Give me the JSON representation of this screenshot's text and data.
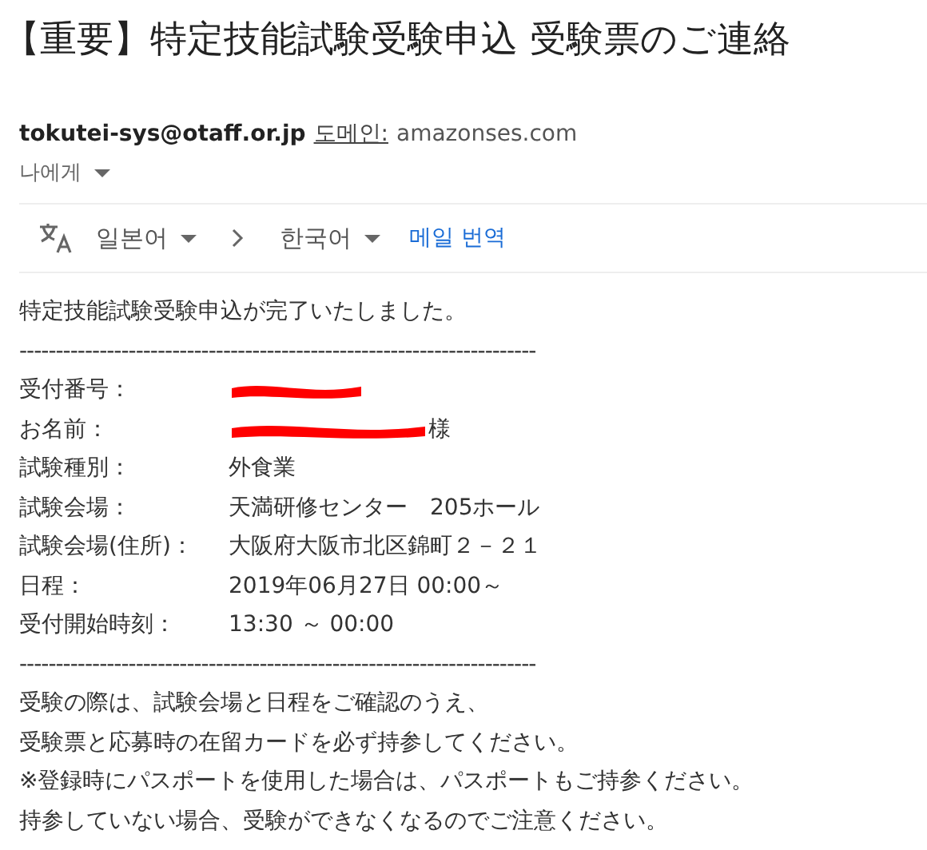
{
  "subject": "【重要】特定技能試験受験申込 受験票のご連絡",
  "sender": {
    "email": "tokutei-sys@otaff.or.jp",
    "domain_label": "도메인:",
    "domain": "amazonses.com",
    "recipient": "나에게"
  },
  "translate_bar": {
    "source": "일본어",
    "target": "한국어",
    "action": "메일 번역"
  },
  "body": {
    "intro": "特定技能試験受験申込が完了いたしました。",
    "separator": "-----------------------------------------------------------------------",
    "rows": [
      {
        "kind": "redacted",
        "label": "受付番号："
      },
      {
        "kind": "redacted",
        "label": "お名前：",
        "suffix": "様"
      },
      {
        "kind": "text",
        "label": "試験種別：",
        "value": "外食業"
      },
      {
        "kind": "text",
        "label": "試験会場：",
        "value": "天満研修センター　205ホール"
      },
      {
        "kind": "text",
        "label": "試験会場(住所)：",
        "value": "大阪府大阪市北区錦町２－２１"
      },
      {
        "kind": "text",
        "label": "日程：",
        "value": "2019年06月27日 00:00～"
      },
      {
        "kind": "text",
        "label": "受付開始時刻：",
        "value": "13:30 ～ 00:00"
      }
    ],
    "separator_2": "-----------------------------------------------------------------------",
    "notes": [
      "受験の際は、試験会場と日程をご確認のうえ、",
      "受験票と応募時の在留カードを必ず持参してください。",
      "※登録時にパスポートを使用した場合は、パスポートもご持参ください。",
      "持参していない場合、受験ができなくなるのでご注意ください。"
    ]
  }
}
